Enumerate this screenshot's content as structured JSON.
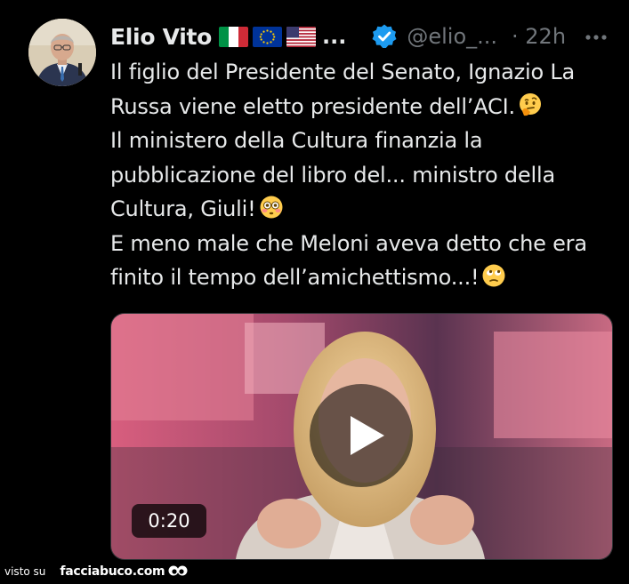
{
  "author": {
    "name": "Elio Vito",
    "name_ellipsis": "...",
    "handle": "@elio_...",
    "time": "· 22h",
    "flags": [
      "italy-flag",
      "eu-flag",
      "usa-flag"
    ],
    "verified": true
  },
  "tweet": {
    "lines": [
      "Il figlio del Presidente del Senato, Ignazio La Russa viene eletto presidente dell’ACI.",
      "Il ministero della Cultura finanzia la pubblicazione del libro del... ministro della Cultura, Giuli!",
      "E meno male che Meloni aveva detto che era finito il tempo dell’amichettismo...!"
    ],
    "emojis": [
      "thinking-face-emoji",
      "flushed-face-emoji",
      "eye-roll-face-emoji"
    ]
  },
  "media": {
    "type": "video",
    "duration": "0:20"
  },
  "watermark": {
    "prefix": "visto su",
    "site": "facciabuco.com"
  },
  "colors": {
    "background": "#000000",
    "text": "#e7e9ea",
    "secondary": "#71767b",
    "verified_blue": "#1d9bf0"
  }
}
